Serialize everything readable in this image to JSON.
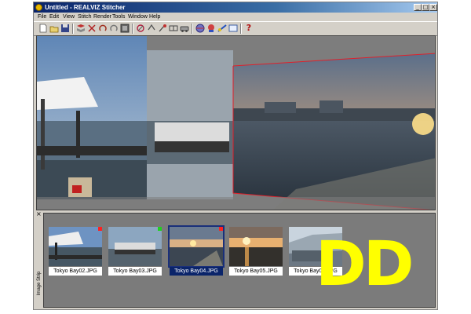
{
  "window": {
    "title": "Untitled - REALVIZ Stitcher",
    "minimize": "_",
    "maximize": "□",
    "close": "×"
  },
  "menu": [
    "File",
    "Edit",
    "View",
    "Stitch",
    "Render",
    "Tools",
    "Window",
    "Help"
  ],
  "toolbar": {
    "icons": [
      "new-icon",
      "open-icon",
      "save-icon",
      "stitch-icon",
      "cut-icon",
      "undo-icon",
      "redo-icon",
      "image-icon",
      "align-icon",
      "link-icon",
      "point-icon",
      "compare-icon",
      "car-icon",
      "sphere-icon",
      "lens-icon",
      "blend-icon",
      "render-icon",
      "help-icon"
    ],
    "help_glyph": "?"
  },
  "image_strip": {
    "close_glyph": "×",
    "label": "Image Strip",
    "thumbnails": [
      {
        "name": "Tokyo Bay02.JPG",
        "badge": "#ff2020",
        "selected": false
      },
      {
        "name": "Tokyo Bay03.JPG",
        "badge": "#20d020",
        "selected": false
      },
      {
        "name": "Tokyo Bay04.JPG",
        "badge": "#ff2020",
        "selected": true
      },
      {
        "name": "Tokyo Bay05.JPG",
        "badge": "",
        "selected": false
      },
      {
        "name": "Tokyo Bay06.JPG",
        "badge": "",
        "selected": false
      }
    ]
  },
  "overlay_text": "DD",
  "colors": {
    "title_bar": "#0a246a",
    "frame_outline": "#e0202a",
    "overlay": "#ffff00"
  }
}
